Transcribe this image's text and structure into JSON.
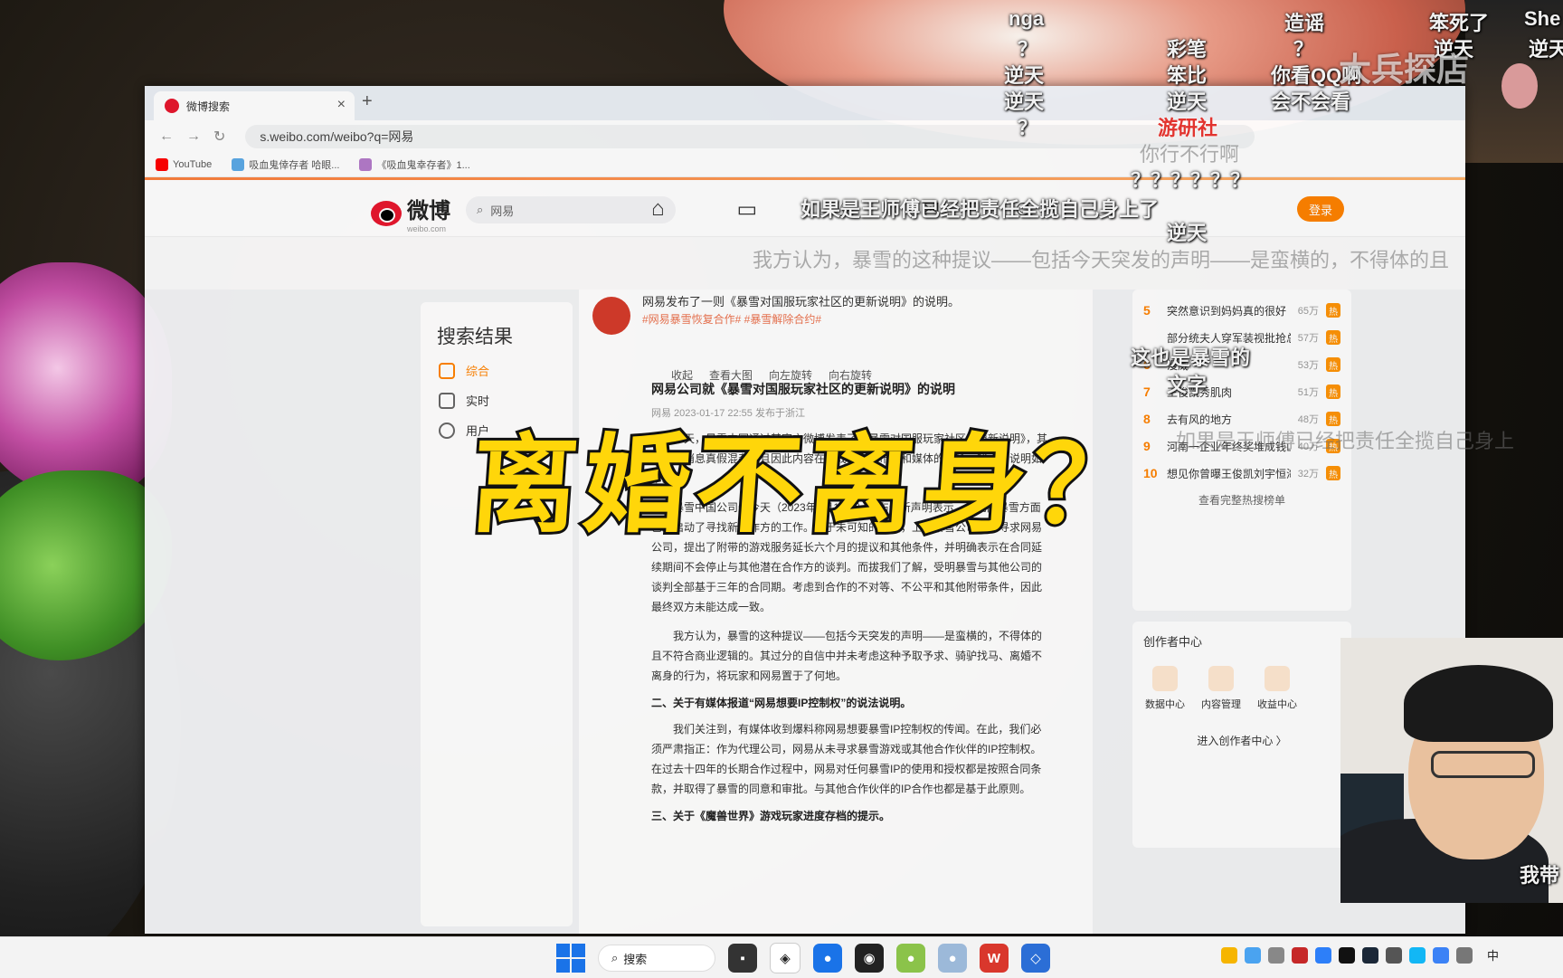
{
  "browser": {
    "tab_title": "微博搜索",
    "url": "s.weibo.com/weibo?q=网易",
    "bookmarks": [
      "YouTube",
      "吸血鬼倖存者 哈眼...",
      "《吸血鬼幸存者》1..."
    ]
  },
  "weibo": {
    "logo_text": "微博",
    "logo_sub": "weibo.com",
    "search_value": "网易",
    "login_label": "登录",
    "left_title": "搜索结果",
    "left_items": [
      "综合",
      "实时",
      "用户"
    ],
    "feed_text": "网易发布了一则《暴雪对国服玩家社区的更新说明》的说明。",
    "feed_tag": "#网易暴雪恢复合作# #暴雪解除合约#",
    "feed_tools": [
      "收起",
      "查看大图",
      "向左旋转",
      "向右旋转"
    ],
    "article_title": "网易公司就《暴雪对国服玩家社区的更新说明》的说明",
    "article_meta": "网易  2023-01-17 22:55  发布于浙江",
    "article_p1": "今天，暴雪中国通过其官方微博发表了《暴雪对国服玩家社区的更新说明》，其中一些消息真假混杂，且因此内容在游戏玩家、市场和媒体的讨论，我方特说明如下。",
    "article_p2": "暴雪中国公司于今天（2023年1月17日）发布最新声明表示，该期间暴雪方面已经启动了寻找新合作方的工作。基于未可知的原因，上周暴雪公司重新寻求网易公司，提出了附带的游戏服务延长六个月的提议和其他条件，并明确表示在合同延续期间不会停止与其他潜在合作方的谈判。而拔我们了解，受明暴雪与其他公司的谈判全部基于三年的合同期。考虑到合作的不对等、不公平和其他附带条件，因此最终双方未能达成一致。",
    "article_p3": "我方认为，暴雪的这种提议——包括今天突发的声明——是蛮横的，不得体的且不符合商业逻辑的。其过分的自信中并未考虑这种予取予求、骑驴找马、离婚不离身的行为，将玩家和网易置于了何地。",
    "article_h2": "二、关于有媒体报道“网易想要IP控制权”的说法说明。",
    "article_p4": "我们关注到，有媒体收到爆料称网易想要暴雪IP控制权的传闻。在此，我们必须严肃指正：作为代理公司，网易从未寻求暴雪游戏或其他合作伙伴的IP控制权。在过去十四年的长期合作过程中，网易对任何暴雪IP的使用和授权都是按照合同条款，并取得了暴雪的同意和审批。与其他合作伙伴的IP合作也都是基于此原则。",
    "article_h3": "三、关于《魔兽世界》游戏玩家进度存档的提示。",
    "hot_list": [
      {
        "no": "5",
        "label": "突然意识到妈妈真的很好",
        "count": "65万"
      },
      {
        "no": "",
        "label": "部分统夫人穿军装视批抢总",
        "count": "57万"
      },
      {
        "no": "6",
        "label": "漫威",
        "count": "53万"
      },
      {
        "no": "7",
        "label": "王俊凯秀肌肉",
        "count": "51万"
      },
      {
        "no": "8",
        "label": "去有风的地方",
        "count": "48万"
      },
      {
        "no": "9",
        "label": "河南一企业年终奖堆成钱山",
        "count": "40万"
      },
      {
        "no": "10",
        "label": "想见你曾曝王俊凯刘宇恒海报",
        "count": "32万"
      }
    ],
    "hot_more": "查看完整热搜榜单",
    "creator_title": "创作者中心",
    "creator_items": [
      "数据中心",
      "内容管理",
      "收益中心"
    ],
    "creator_link": "进入创作者中心 〉"
  },
  "overlay": {
    "caption": "离婚不离身？",
    "watermark": "大兵探店",
    "danmaku": [
      "nga",
      "？",
      "逆天",
      "逆天",
      "？",
      "彩笔",
      "笨比",
      "逆天",
      "造谣",
      "？",
      "你看QQ啊",
      "会不会看",
      "笨死了",
      "逆天",
      "She",
      "逆天",
      "游研社",
      "你行不行啊",
      "？？？？？？",
      "逆天",
      "这也是暴雪的",
      "文字",
      "如果是王师傅已经把责任全揽自己身上了",
      "我方认为，暴雪的这种提议——包括今天突发的声明——是蛮横的，不得体的且",
      "如果是王师傅已经把责任全揽自己身上",
      "我带"
    ]
  },
  "taskbar": {
    "search_label": "搜索",
    "ime": "中"
  }
}
